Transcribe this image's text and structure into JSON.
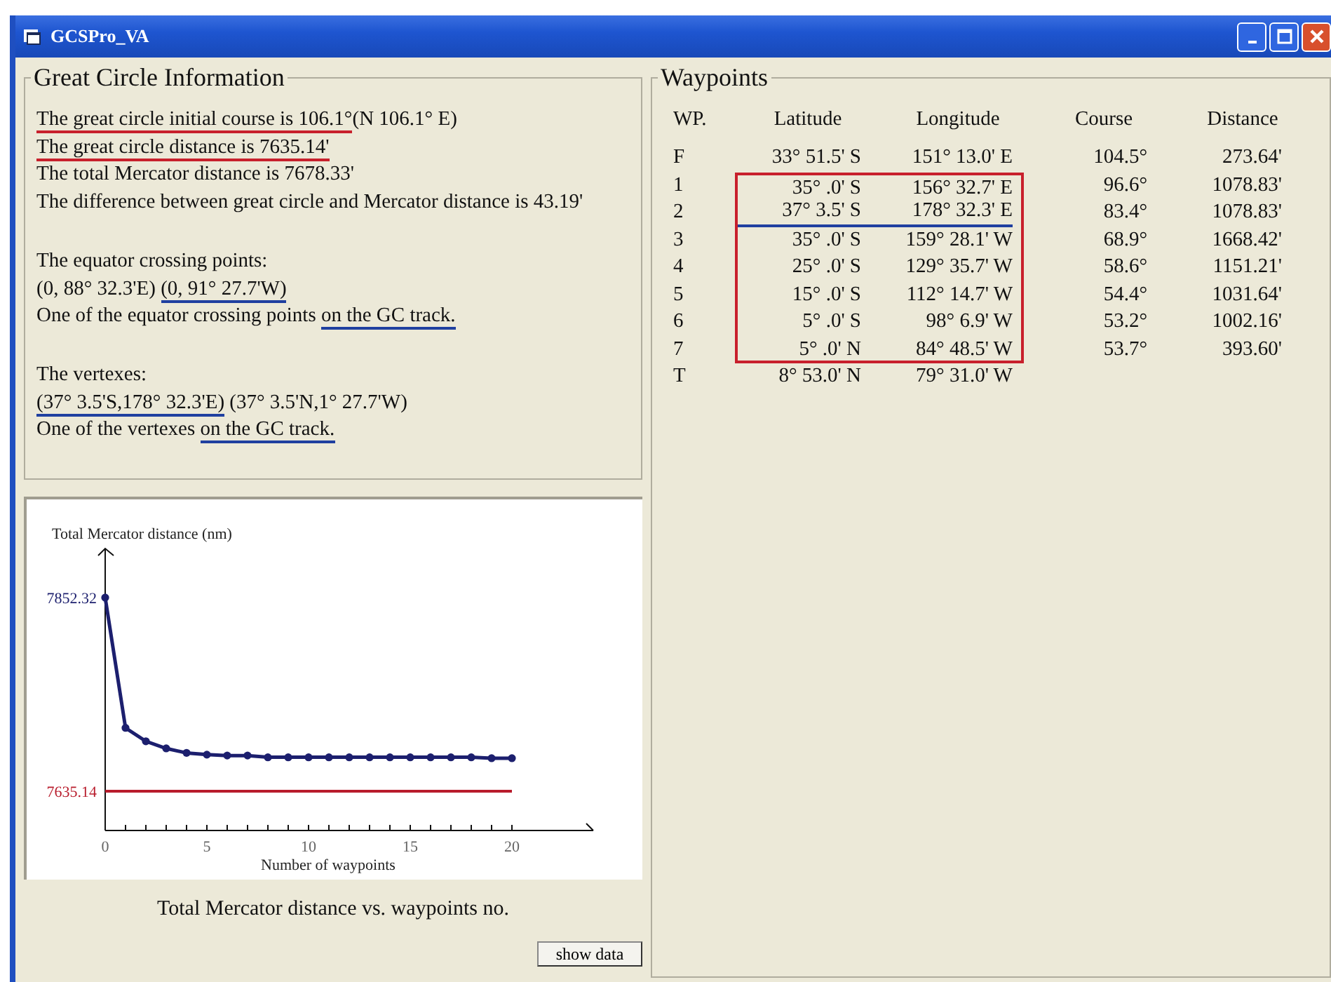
{
  "window": {
    "title": "GCSPro_VA"
  },
  "great_circle_info": {
    "title": "Great Circle Information",
    "groups": [
      [
        [
          {
            "text": "The great circle initial course is  106.1°",
            "color": "#c8202c"
          },
          {
            "text": "(N 106.1° E)"
          }
        ],
        [
          {
            "text": "The great circle distance is 7635.14'",
            "color": "#c8202c"
          }
        ],
        [
          {
            "text": "The total Mercator distance is 7678.33'"
          }
        ],
        [
          {
            "text": "The difference between great circle and Mercator distance is 43.19'"
          }
        ]
      ],
      [
        [
          {
            "text": "The equator crossing points:"
          }
        ],
        [
          {
            "text": "(0, 88° 32.3'E) "
          },
          {
            "text": "(0, 91° 27.7'W)",
            "color": "#2040a0"
          }
        ],
        [
          {
            "text": "One of the equator crossing points "
          },
          {
            "text": "on the GC track.",
            "color": "#2040a0"
          }
        ]
      ],
      [
        [
          {
            "text": "The vertexes:"
          }
        ],
        [
          {
            "text": "(37° 3.5'S,178° 32.3'E)",
            "color": "#2040a0"
          },
          {
            "text": "  (37° 3.5'N,1° 27.7'W)"
          }
        ],
        [
          {
            "text": "One of the vertexes "
          },
          {
            "text": "on the GC track.",
            "color": "#2040a0"
          }
        ]
      ]
    ]
  },
  "chart": {
    "caption": "Total Mercator distance vs. waypoints no.",
    "chart_data": {
      "type": "line",
      "ylabel": "Total Mercator distance (nm)",
      "xlabel": "Number of waypoints",
      "x": [
        0,
        1,
        2,
        3,
        4,
        5,
        6,
        7,
        8,
        9,
        10,
        11,
        12,
        13,
        14,
        15,
        16,
        17,
        18,
        19,
        20
      ],
      "series": [
        {
          "color": "#1c1f6e",
          "marker": "circle",
          "values": [
            7852,
            7706,
            7691,
            7683,
            7678,
            7676,
            7675,
            7675,
            7673,
            7673,
            7673,
            7673,
            7673,
            7673,
            7673,
            7673,
            7673,
            7673,
            7673,
            7672,
            7672
          ]
        },
        {
          "color": "#b81c2c",
          "values": [
            7635,
            7635,
            7635,
            7635,
            7635,
            7635,
            7635,
            7635,
            7635,
            7635,
            7635,
            7635,
            7635,
            7635,
            7635,
            7635,
            7635,
            7635,
            7635,
            7635,
            7635
          ]
        }
      ],
      "xlim": [
        0,
        24
      ],
      "ylim": [
        7591,
        7907
      ],
      "xticks": [
        0,
        5,
        10,
        15,
        20
      ],
      "yticks": [
        7852.32,
        7635.14
      ]
    }
  },
  "show_data_button": "show data",
  "waypoints": {
    "title": "Waypoints",
    "columns": [
      "WP.",
      "Latitude",
      "Longitude",
      "Course",
      "Distance"
    ],
    "rows": [
      {
        "wp": "F",
        "latitude": "33° 51.5' S",
        "longitude": "151° 13.0' E",
        "course": "104.5°",
        "distance": "273.64'",
        "boxed": false,
        "underlined": false
      },
      {
        "wp": "1",
        "latitude": "35° .0' S",
        "longitude": "156° 32.7' E",
        "course": "96.6°",
        "distance": "1078.83'",
        "boxed": true,
        "underlined": false
      },
      {
        "wp": "2",
        "latitude": "37° 3.5' S",
        "longitude": "178° 32.3' E",
        "course": "83.4°",
        "distance": "1078.83'",
        "boxed": true,
        "underlined": true
      },
      {
        "wp": "3",
        "latitude": "35° .0' S",
        "longitude": "159° 28.1' W",
        "course": "68.9°",
        "distance": "1668.42'",
        "boxed": true,
        "underlined": false
      },
      {
        "wp": "4",
        "latitude": "25° .0' S",
        "longitude": "129° 35.7' W",
        "course": "58.6°",
        "distance": "1151.21'",
        "boxed": true,
        "underlined": false
      },
      {
        "wp": "5",
        "latitude": "15° .0' S",
        "longitude": "112° 14.7' W",
        "course": "54.4°",
        "distance": "1031.64'",
        "boxed": true,
        "underlined": false
      },
      {
        "wp": "6",
        "latitude": "5° .0' S",
        "longitude": "98° 6.9' W",
        "course": "53.2°",
        "distance": "1002.16'",
        "boxed": true,
        "underlined": false
      },
      {
        "wp": "7",
        "latitude": "5° .0' N",
        "longitude": "84° 48.5' W",
        "course": "53.7°",
        "distance": "393.60'",
        "boxed": true,
        "underlined": false
      },
      {
        "wp": "T",
        "latitude": "8° 53.0' N",
        "longitude": "79° 31.0' W",
        "boxed": false,
        "underlined": false
      }
    ]
  }
}
